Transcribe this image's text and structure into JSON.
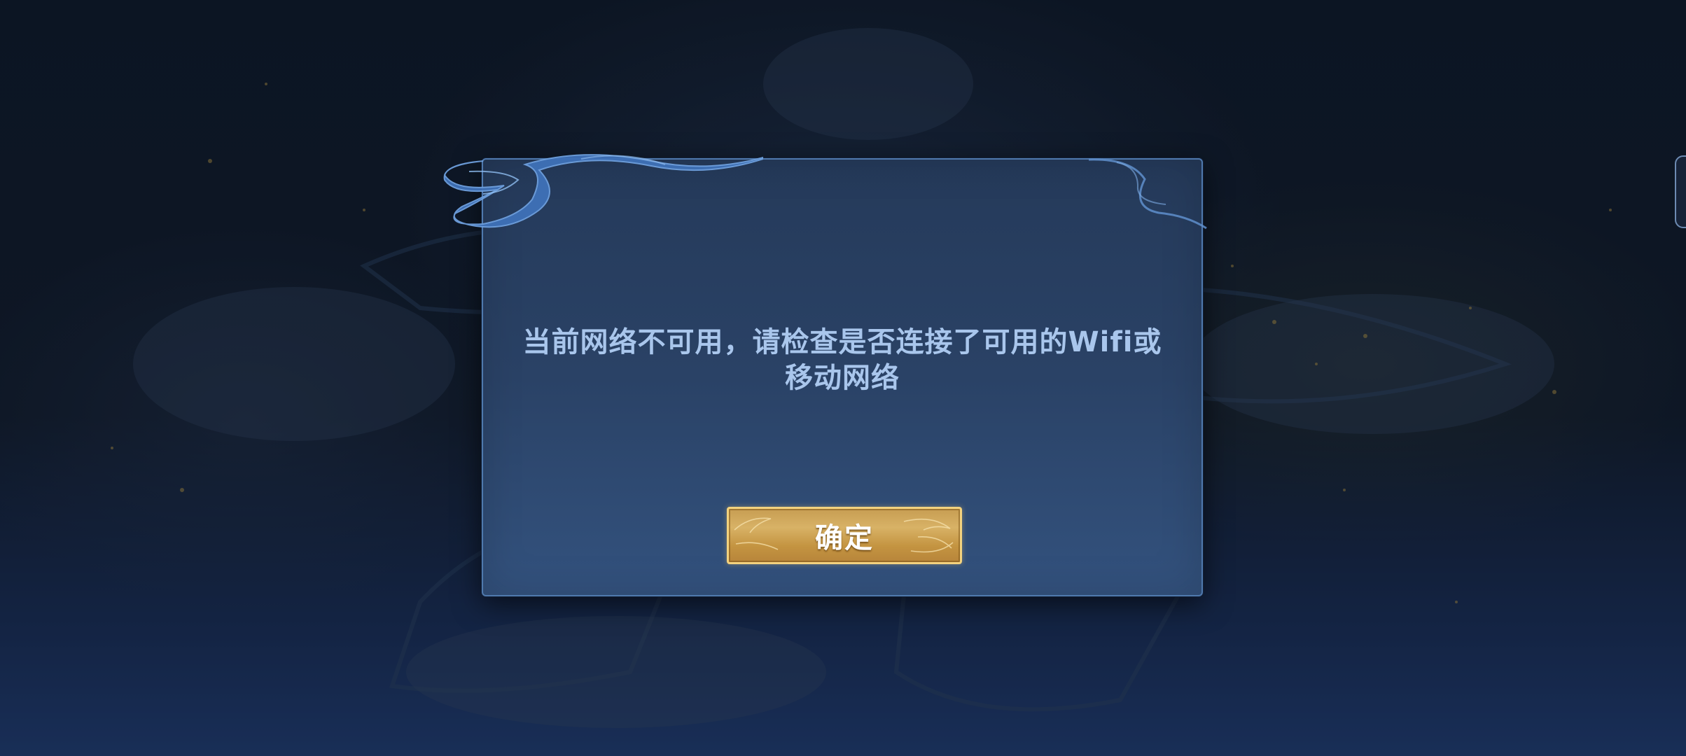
{
  "dialog": {
    "message": "当前网络不可用，请检查是否连接了可用的Wifi或移动网络",
    "confirm_label": "确定"
  },
  "colors": {
    "dialog_border": "#4f79ad",
    "dialog_fill": "#2a4266",
    "message_text": "#a9c6ec",
    "button_gold": "#d8b266",
    "button_border": "#f3d27e"
  },
  "icons": {
    "dialog_ornament": "cloud-swirl",
    "button_ornament": "gold-filigree",
    "edge_tab": "side-tab"
  }
}
